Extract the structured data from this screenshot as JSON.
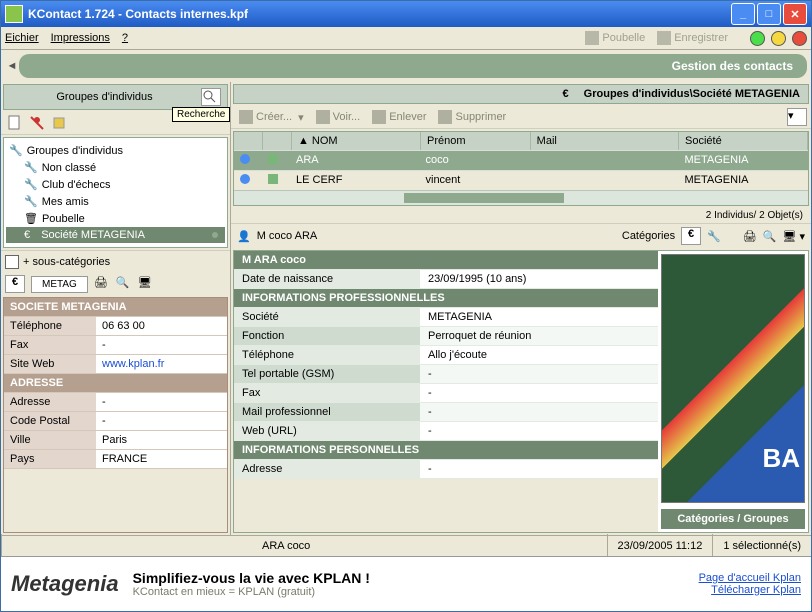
{
  "window": {
    "title": "KContact  1.724 - Contacts internes.kpf"
  },
  "menu": {
    "file": "Eichier",
    "print": "Impressions",
    "help": "?",
    "trash": "Poubelle",
    "save": "Enregistrer"
  },
  "banner": "Gestion des contacts",
  "left": {
    "panel_title": "Groupes d'individus",
    "tree": {
      "root": "Groupes d'individus",
      "items": [
        "Non classé",
        "Club d'échecs",
        "Mes amis",
        "Poubelle"
      ],
      "selected": "Société METAGENIA"
    },
    "subcats_label": "+ sous-catégories",
    "tab": "METAG",
    "society": {
      "header": "SOCIETE  METAGENIA",
      "rows": [
        {
          "label": "Téléphone",
          "value": "06 63 00"
        },
        {
          "label": "Fax",
          "value": "-"
        },
        {
          "label": "Site Web",
          "value": "www.kplan.fr",
          "link": true
        }
      ],
      "addr_header": "ADRESSE",
      "addr_rows": [
        {
          "label": "Adresse",
          "value": "-"
        },
        {
          "label": "Code Postal",
          "value": "-"
        },
        {
          "label": "Ville",
          "value": "Paris"
        },
        {
          "label": "Pays",
          "value": "FRANCE"
        }
      ]
    }
  },
  "right": {
    "crumb": "Groupes d'individus\\Société METAGENIA",
    "toolbar": {
      "create": "Créer...",
      "view": "Voir...",
      "remove": "Enlever",
      "delete": "Supprimer",
      "search_tip": "Recherche"
    },
    "table": {
      "cols": {
        "name": "NOM",
        "first": "Prénom",
        "mail": "Mail",
        "company": "Société"
      },
      "rows": [
        {
          "name": "ARA",
          "first": "coco",
          "mail": "",
          "company": "METAGENIA",
          "selected": true
        },
        {
          "name": "LE CERF",
          "first": "vincent",
          "mail": "",
          "company": "METAGENIA"
        }
      ],
      "footer": "2 Individus/ 2 Objet(s)"
    },
    "detail": {
      "barname": "M coco ARA",
      "cats_label": "Catégories",
      "title": "M ARA coco",
      "birth_label": "Date de naissance",
      "birth_value": "23/09/1995 (10 ans)",
      "pro_header": "INFORMATIONS PROFESSIONNELLES",
      "pro_rows": [
        {
          "label": "Société",
          "value": "METAGENIA"
        },
        {
          "label": "Fonction",
          "value": "Perroquet de réunion"
        },
        {
          "label": "Téléphone",
          "value": "Allo j'écoute"
        },
        {
          "label": "Tel portable (GSM)",
          "value": "-"
        },
        {
          "label": "Fax",
          "value": "-"
        },
        {
          "label": "Mail professionnel",
          "value": "-"
        },
        {
          "label": "Web (URL)",
          "value": "-"
        }
      ],
      "pers_header": "INFORMATIONS PERSONNELLES",
      "pers_rows": [
        {
          "label": "Adresse",
          "value": "-"
        }
      ],
      "cat_button": "Catégories / Groupes"
    }
  },
  "status": {
    "name": "ARA coco",
    "date": "23/09/2005 11:12",
    "sel": "1 sélectionné(s)"
  },
  "footer": {
    "brand": "Metagenia",
    "line1": "Simplifiez-vous la vie avec KPLAN !",
    "line2": "KContact en mieux = KPLAN (gratuit)",
    "link1": "Page d'accueil Kplan",
    "link2": "Télécharger Kplan"
  },
  "euro": "€"
}
